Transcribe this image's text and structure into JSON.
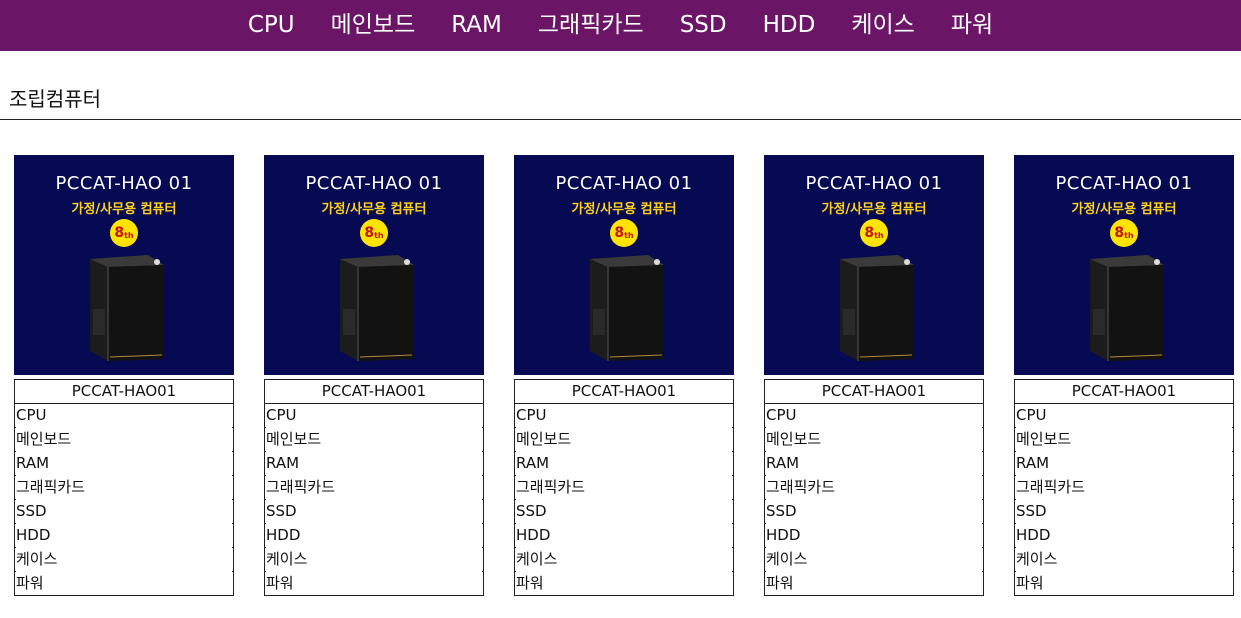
{
  "nav": {
    "items": [
      "CPU",
      "메인보드",
      "RAM",
      "그래픽카드",
      "SSD",
      "HDD",
      "케이스",
      "파워"
    ]
  },
  "section": {
    "title": "조립컴퓨터"
  },
  "products": [
    {
      "thumb_title": "PCCAT-HAO 01",
      "thumb_sub": "가정/사무용 컴퓨터",
      "badge": "8",
      "badge_sup": "th",
      "name": "PCCAT-HAO01",
      "specs": [
        "CPU",
        "메인보드",
        "RAM",
        "그래픽카드",
        "SSD",
        "HDD",
        "케이스",
        "파워"
      ]
    },
    {
      "thumb_title": "PCCAT-HAO 01",
      "thumb_sub": "가정/사무용 컴퓨터",
      "badge": "8",
      "badge_sup": "th",
      "name": "PCCAT-HAO01",
      "specs": [
        "CPU",
        "메인보드",
        "RAM",
        "그래픽카드",
        "SSD",
        "HDD",
        "케이스",
        "파워"
      ]
    },
    {
      "thumb_title": "PCCAT-HAO 01",
      "thumb_sub": "가정/사무용 컴퓨터",
      "badge": "8",
      "badge_sup": "th",
      "name": "PCCAT-HAO01",
      "specs": [
        "CPU",
        "메인보드",
        "RAM",
        "그래픽카드",
        "SSD",
        "HDD",
        "케이스",
        "파워"
      ]
    },
    {
      "thumb_title": "PCCAT-HAO 01",
      "thumb_sub": "가정/사무용 컴퓨터",
      "badge": "8",
      "badge_sup": "th",
      "name": "PCCAT-HAO01",
      "specs": [
        "CPU",
        "메인보드",
        "RAM",
        "그래픽카드",
        "SSD",
        "HDD",
        "케이스",
        "파워"
      ]
    },
    {
      "thumb_title": "PCCAT-HAO 01",
      "thumb_sub": "가정/사무용 컴퓨터",
      "badge": "8",
      "badge_sup": "th",
      "name": "PCCAT-HAO01",
      "specs": [
        "CPU",
        "메인보드",
        "RAM",
        "그래픽카드",
        "SSD",
        "HDD",
        "케이스",
        "파워"
      ]
    }
  ],
  "colors": {
    "nav_bg": "#6b1566",
    "thumb_bg": "#060a52",
    "accent_yellow": "#ffd21f"
  }
}
